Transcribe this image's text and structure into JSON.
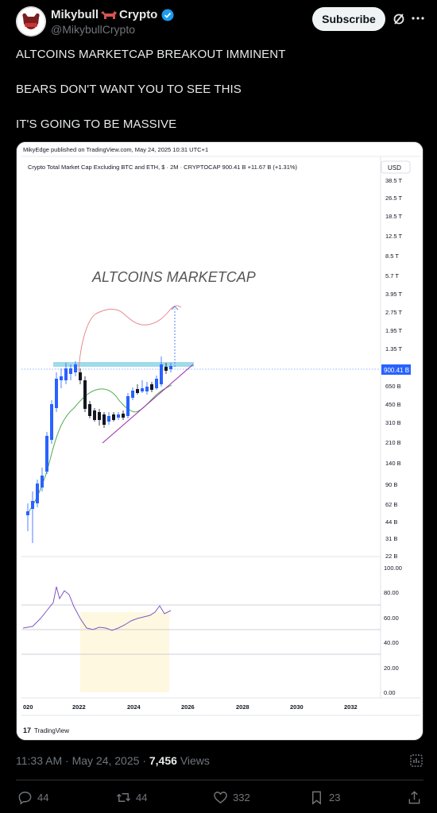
{
  "author": {
    "name_left": "Mikybull",
    "name_right": "Crypto",
    "handle": "@MikybullCrypto",
    "subscribe_label": "Subscribe"
  },
  "tweet": {
    "lines": [
      "ALTCOINS MARKETCAP BREAKOUT IMMINENT",
      "BEARS DON'T WANT YOU TO SEE THIS",
      "IT'S GOING TO BE MASSIVE"
    ]
  },
  "chart": {
    "published": "MikyEdge published on TradingView.com, May 24, 2025 10:31 UTC+1",
    "symbol_line": "Crypto Total Market Cap Excluding BTC and ETH, $ · 2M · CRYPTOCAP  900.41 B  +11.67 B (+1.31%)",
    "currency": "USD",
    "title": "ALTCOINS MARKETCAP",
    "price_label": "900.41 B",
    "watermark": "TradingView",
    "accent_color": "#2962ff",
    "resistance_color": "#8fd3e8"
  },
  "chart_data": {
    "type": "line",
    "scale": "log",
    "y_ticks": [
      "38.5 T",
      "26.5 T",
      "18.5 T",
      "12.5 T",
      "8.5 T",
      "5.7 T",
      "3.95 T",
      "2.75 T",
      "1.95 T",
      "1.35 T",
      "650 B",
      "450 B",
      "310 B",
      "210 B",
      "140 B",
      "90 B",
      "62 B",
      "44 B",
      "31 B",
      "22 B"
    ],
    "rsi_ticks": [
      "100.00",
      "80.00",
      "60.00",
      "40.00",
      "20.00",
      "0.00"
    ],
    "x_ticks": [
      "020",
      "2022",
      "2024",
      "2026",
      "2028",
      "2030",
      "2032"
    ],
    "last_value": "900.41 B",
    "change": "+11.67 B (+1.31%)"
  },
  "meta": {
    "time": "11:33 AM",
    "date": "May 24, 2025",
    "views_count": "7,456",
    "views_label": "Views"
  },
  "actions": {
    "replies": "44",
    "reposts": "44",
    "likes": "332",
    "bookmarks": "23"
  }
}
